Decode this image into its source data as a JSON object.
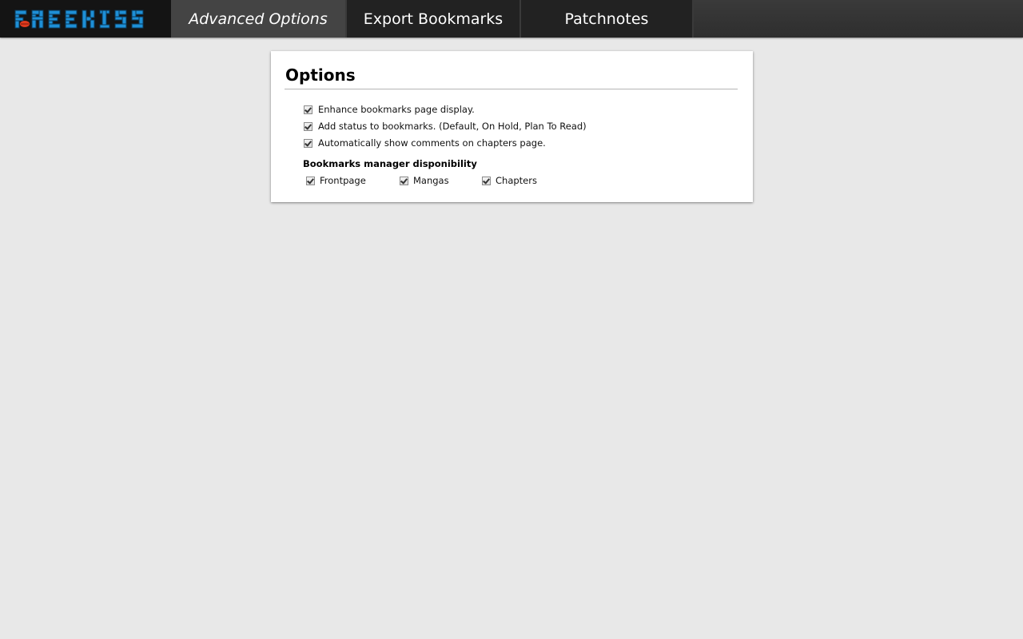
{
  "app": {
    "logo_text": "FREEKISS",
    "logo_color": "#1e8fd6",
    "logo_accent_color": "#e03a1e"
  },
  "nav": {
    "tabs": [
      {
        "label": "Advanced Options",
        "active": true
      },
      {
        "label": "Export Bookmarks",
        "active": false
      },
      {
        "label": "Patchnotes",
        "active": false
      }
    ]
  },
  "options": {
    "title": "Options",
    "items": [
      {
        "label": "Enhance bookmarks page display.",
        "checked": true
      },
      {
        "label": "Add status to bookmarks. (Default, On Hold, Plan To Read)",
        "checked": true
      },
      {
        "label": "Automatically show comments on chapters page.",
        "checked": true
      }
    ],
    "manager": {
      "title": "Bookmarks manager disponibility",
      "items": [
        {
          "label": "Frontpage",
          "checked": true
        },
        {
          "label": "Mangas",
          "checked": true
        },
        {
          "label": "Chapters",
          "checked": true
        }
      ]
    }
  }
}
